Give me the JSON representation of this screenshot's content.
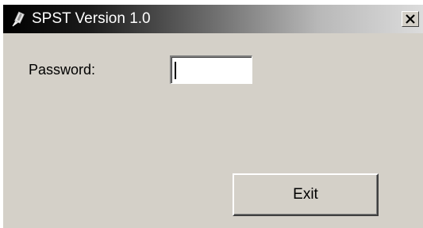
{
  "window": {
    "title": "SPST Version 1.0",
    "icon": "app-icon",
    "close_glyph": "×"
  },
  "form": {
    "password_label": "Password:",
    "password_value": ""
  },
  "buttons": {
    "exit_label": "Exit"
  },
  "colors": {
    "face": "#d4d0c8",
    "titlebar_start": "#000000",
    "titlebar_end": "#dcdcdc"
  }
}
